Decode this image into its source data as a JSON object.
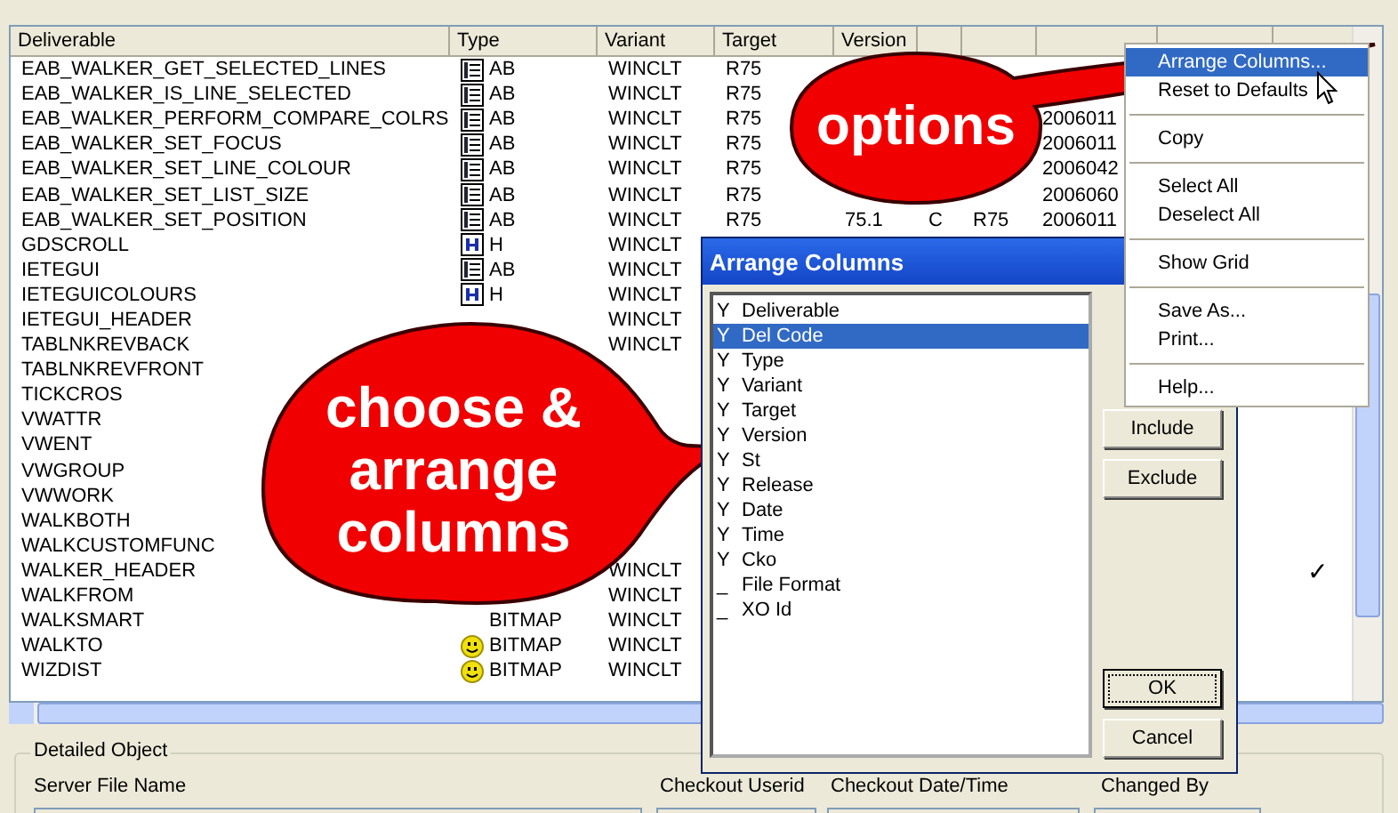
{
  "table": {
    "columns": [
      "Deliverable",
      "Type",
      "Variant",
      "Target",
      "Version"
    ],
    "rows": [
      {
        "deliverable": "EAB_WALKER_GET_SELECTED_LINES",
        "kind": "ab",
        "type": "AB",
        "variant": "WINCLT",
        "target": "R75"
      },
      {
        "deliverable": "EAB_WALKER_IS_LINE_SELECTED",
        "kind": "ab",
        "type": "AB",
        "variant": "WINCLT",
        "target": "R75"
      },
      {
        "deliverable": "EAB_WALKER_PERFORM_COMPARE_COLRS",
        "kind": "ab",
        "type": "AB",
        "variant": "WINCLT",
        "target": "R75",
        "date": "2006011"
      },
      {
        "deliverable": "EAB_WALKER_SET_FOCUS",
        "kind": "ab",
        "type": "AB",
        "variant": "WINCLT",
        "target": "R75",
        "date": "2006011"
      },
      {
        "deliverable": "EAB_WALKER_SET_LINE_COLOUR",
        "kind": "ab",
        "type": "AB",
        "variant": "WINCLT",
        "target": "R75",
        "date": "2006042"
      },
      {
        "deliverable": "EAB_WALKER_SET_LIST_SIZE",
        "kind": "ab",
        "type": "AB",
        "variant": "WINCLT",
        "target": "R75",
        "date": "2006060"
      },
      {
        "deliverable": "EAB_WALKER_SET_POSITION",
        "kind": "ab",
        "type": "AB",
        "variant": "WINCLT",
        "target": "R75",
        "version": "75.1",
        "st": "C",
        "release": "R75",
        "date": "2006011"
      },
      {
        "deliverable": "GDSCROLL",
        "kind": "h",
        "type": "H",
        "variant": "WINCLT"
      },
      {
        "deliverable": "IETEGUI",
        "kind": "ab",
        "type": "AB",
        "variant": "WINCLT"
      },
      {
        "deliverable": "IETEGUICOLOURS",
        "kind": "h",
        "type": "H",
        "variant": "WINCLT"
      },
      {
        "deliverable": "IETEGUI_HEADER",
        "variant": "WINCLT"
      },
      {
        "deliverable": "TABLNKREVBACK",
        "variant": "WINCLT"
      },
      {
        "deliverable": "TABLNKREVFRONT"
      },
      {
        "deliverable": "TICKCROS"
      },
      {
        "deliverable": "VWATTR"
      },
      {
        "deliverable": "VWENT"
      },
      {
        "deliverable": "VWGROUP"
      },
      {
        "deliverable": "VWWORK"
      },
      {
        "deliverable": "WALKBOTH"
      },
      {
        "deliverable": "WALKCUSTOMFUNC"
      },
      {
        "deliverable": "WALKER_HEADER",
        "variant": "WINCLT",
        "cko": "✓"
      },
      {
        "deliverable": "WALKFROM",
        "variant": "WINCLT"
      },
      {
        "deliverable": "WALKSMART",
        "type": "BITMAP",
        "variant": "WINCLT"
      },
      {
        "deliverable": "WALKTO",
        "kind": "smiley",
        "type": "BITMAP",
        "variant": "WINCLT"
      },
      {
        "deliverable": "WIZDIST",
        "kind": "smiley",
        "type": "BITMAP",
        "variant": "WINCLT"
      }
    ]
  },
  "detailed_object": {
    "title": "Detailed Object",
    "fields": [
      "Server File Name",
      "Checkout Userid",
      "Checkout Date/Time",
      "Changed By"
    ]
  },
  "dialog": {
    "title": "Arrange Columns",
    "columns": [
      {
        "flag": "Y",
        "label": "Deliverable",
        "selected": false
      },
      {
        "flag": "Y",
        "label": "Del Code",
        "selected": true
      },
      {
        "flag": "Y",
        "label": "Type",
        "selected": false
      },
      {
        "flag": "Y",
        "label": "Variant",
        "selected": false
      },
      {
        "flag": "Y",
        "label": "Target",
        "selected": false
      },
      {
        "flag": "Y",
        "label": "Version",
        "selected": false
      },
      {
        "flag": "Y",
        "label": "St",
        "selected": false
      },
      {
        "flag": "Y",
        "label": "Release",
        "selected": false
      },
      {
        "flag": "Y",
        "label": "Date",
        "selected": false
      },
      {
        "flag": "Y",
        "label": "Time",
        "selected": false
      },
      {
        "flag": "Y",
        "label": "Cko",
        "selected": false
      },
      {
        "flag": "_",
        "label": "File Format",
        "selected": false
      },
      {
        "flag": "_",
        "label": "XO Id",
        "selected": false
      }
    ],
    "side_buttons": [
      "Include",
      "Exclude"
    ],
    "ok": "OK",
    "cancel": "Cancel"
  },
  "context_menu": [
    {
      "kind": "item",
      "label": "Arrange Columns...",
      "selected": true
    },
    {
      "kind": "item",
      "label": "Reset to Defaults",
      "selected": false
    },
    {
      "kind": "separator"
    },
    {
      "kind": "item",
      "label": "Copy",
      "selected": false
    },
    {
      "kind": "separator"
    },
    {
      "kind": "item",
      "label": "Select All",
      "selected": false
    },
    {
      "kind": "item",
      "label": "Deselect All",
      "selected": false
    },
    {
      "kind": "separator"
    },
    {
      "kind": "item",
      "label": "Show Grid",
      "selected": false
    },
    {
      "kind": "separator"
    },
    {
      "kind": "item",
      "label": "Save As...",
      "selected": false
    },
    {
      "kind": "item",
      "label": "Print...",
      "selected": false
    },
    {
      "kind": "separator"
    },
    {
      "kind": "item",
      "label": "Help...",
      "selected": false
    }
  ],
  "callouts": [
    {
      "text": "options"
    },
    {
      "text": "choose & arrange columns"
    }
  ]
}
